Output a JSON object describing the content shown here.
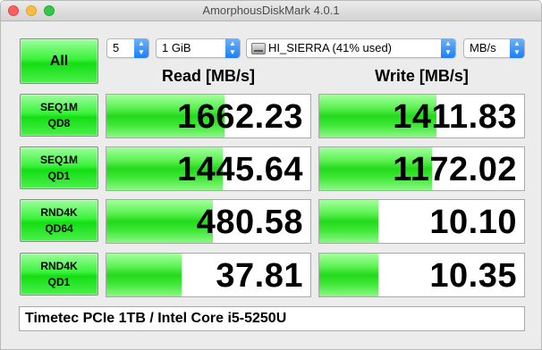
{
  "window": {
    "title": "AmorphousDiskMark 4.0.1"
  },
  "controls": {
    "all_label": "All",
    "count": "5",
    "size": "1 GiB",
    "drive": "HI_SIERRA (41% used)",
    "unit": "MB/s"
  },
  "headers": {
    "read": "Read [MB/s]",
    "write": "Write [MB/s]"
  },
  "tests": [
    {
      "line1": "SEQ1M",
      "line2": "QD8",
      "read": "1662.23",
      "write": "1411.83",
      "read_fill": 0.58,
      "write_fill": 0.57
    },
    {
      "line1": "SEQ1M",
      "line2": "QD1",
      "read": "1445.64",
      "write": "1172.02",
      "read_fill": 0.57,
      "write_fill": 0.55
    },
    {
      "line1": "RND4K",
      "line2": "QD64",
      "read": "480.58",
      "write": "10.10",
      "read_fill": 0.52,
      "write_fill": 0.29
    },
    {
      "line1": "RND4K",
      "line2": "QD1",
      "read": "37.81",
      "write": "10.35",
      "read_fill": 0.37,
      "write_fill": 0.29
    }
  ],
  "comment": "Timetec PCIe 1TB / Intel Core i5-5250U",
  "colors": {
    "accent_green": "#3cf23c",
    "select_blue": "#1b7ff6"
  },
  "icons": [
    "close-icon",
    "minimize-icon",
    "zoom-icon",
    "chevron-updown-icon",
    "disk-icon"
  ]
}
